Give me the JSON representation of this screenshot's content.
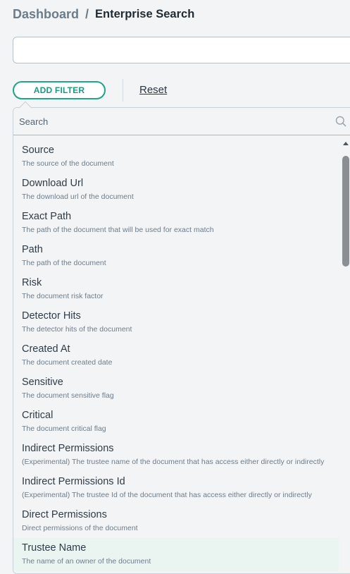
{
  "breadcrumb": {
    "parent": "Dashboard",
    "separator": "/",
    "current": "Enterprise Search"
  },
  "query": {
    "value": "",
    "placeholder": ""
  },
  "toolbar": {
    "add_filter_label": "ADD FILTER",
    "reset_label": "Reset"
  },
  "filter_dropdown": {
    "search_placeholder": "Search",
    "search_icon": "magnifier-icon",
    "items": [
      {
        "title": "Source",
        "description": "The source of the document"
      },
      {
        "title": "Download Url",
        "description": "The download url of the document"
      },
      {
        "title": "Exact Path",
        "description": "The path of the document that will be used for exact match"
      },
      {
        "title": "Path",
        "description": "The path of the document"
      },
      {
        "title": "Risk",
        "description": "The document risk factor"
      },
      {
        "title": "Detector Hits",
        "description": "The detector hits of the document"
      },
      {
        "title": "Created At",
        "description": "The document created date"
      },
      {
        "title": "Sensitive",
        "description": "The document sensitive flag"
      },
      {
        "title": "Critical",
        "description": "The document critical flag"
      },
      {
        "title": "Indirect Permissions",
        "description": "(Experimental) The trustee name of the document that has access either directly or indirectly"
      },
      {
        "title": "Indirect Permissions Id",
        "description": "(Experimental) The trustee Id of the document that has access either directly or indirectly"
      },
      {
        "title": "Direct Permissions",
        "description": "Direct permissions of the document"
      },
      {
        "title": "Trustee Name",
        "description": "The name of an owner of the document"
      }
    ],
    "highlighted_item": "Trustee Name"
  },
  "colors": {
    "accent": "#1ea58a",
    "highlight_row": "#eaf5f2",
    "background": "#f3f4f6"
  }
}
